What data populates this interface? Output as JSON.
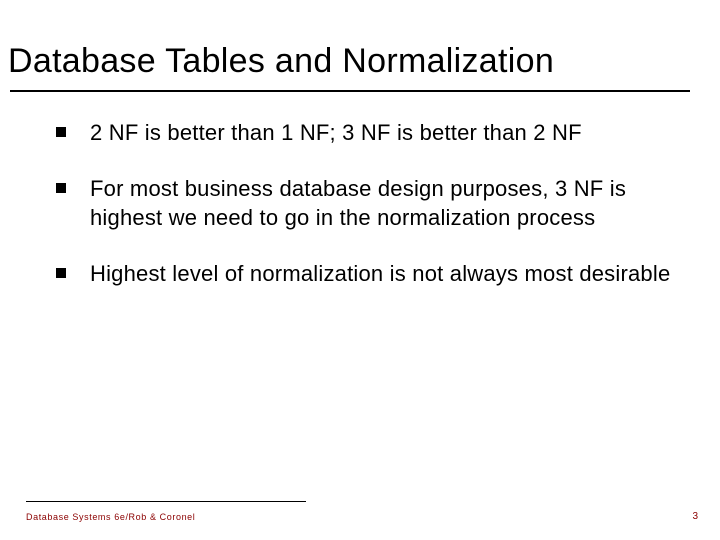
{
  "slide": {
    "title": "Database Tables and Normalization",
    "bullets": [
      "2 NF is better than 1 NF; 3 NF is better than 2 NF",
      "For most business database design purposes, 3 NF is highest we need to go in the normalization process",
      "Highest level of normalization is not always most desirable"
    ],
    "footer": "Database Systems 6e/Rob & Coronel",
    "page_number": "3"
  }
}
